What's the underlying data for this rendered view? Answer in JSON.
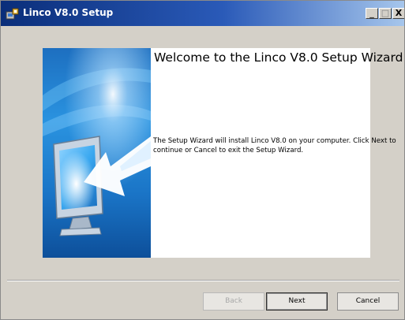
{
  "window": {
    "title": "Linco V8.0 Setup",
    "minimize_label": "_",
    "maximize_label": "□",
    "close_label": "X"
  },
  "wizard": {
    "heading": "Welcome to the Linco V8.0 Setup Wizard",
    "description": "The Setup Wizard will install Linco V8.0 on your computer. Click Next to continue or Cancel to exit the Setup Wizard."
  },
  "buttons": {
    "back": "Back",
    "next": "Next",
    "cancel": "Cancel",
    "back_enabled": false
  },
  "icons": {
    "title_icon": "installer-icon",
    "banner_image": "monitor-arrow-illustration"
  },
  "colors": {
    "titlebar_start": "#0a2e7a",
    "titlebar_end": "#a6c6ec",
    "banner_blue": "#1f7fd0",
    "dialog_background": "#d4d0c8"
  }
}
